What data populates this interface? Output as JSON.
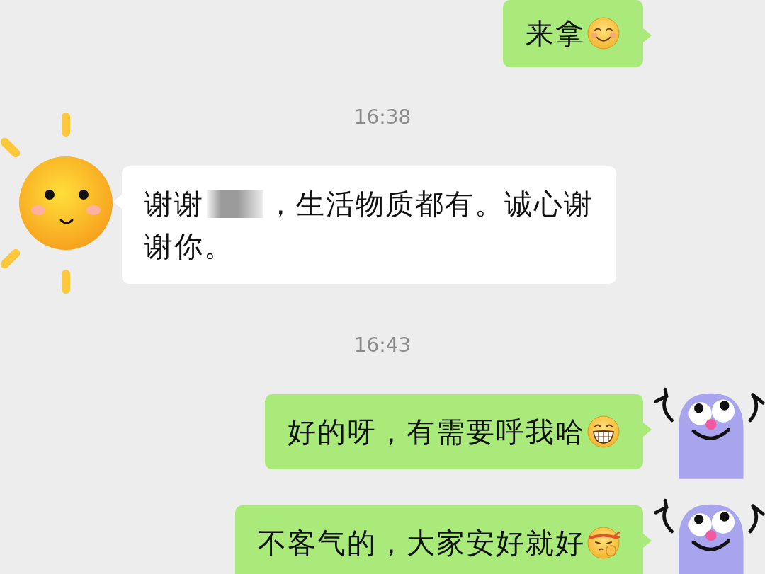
{
  "messages": [
    {
      "kind": "sent",
      "avatar_visible": false,
      "lines": [
        [
          {
            "kind": "text",
            "text": "来拿"
          },
          {
            "kind": "smile-emoji"
          }
        ]
      ]
    },
    {
      "kind": "time",
      "text": "16:38"
    },
    {
      "kind": "received",
      "avatar_visible": true,
      "lines": [
        [
          {
            "kind": "text",
            "text": "谢谢"
          },
          {
            "kind": "redacted"
          },
          {
            "kind": "text",
            "text": "，生活物质都有。诚心谢"
          }
        ],
        [
          {
            "kind": "text",
            "text": "谢你。"
          }
        ]
      ]
    },
    {
      "kind": "time",
      "text": "16:43"
    },
    {
      "kind": "sent",
      "avatar_visible": true,
      "lines": [
        [
          {
            "kind": "text",
            "text": "好的呀，有需要呼我哈"
          },
          {
            "kind": "grin-emoji"
          }
        ]
      ]
    },
    {
      "kind": "sent",
      "avatar_visible": true,
      "lines": [
        [
          {
            "kind": "text",
            "text": "不客气的，大家安好就好"
          },
          {
            "kind": "headband-emoji"
          }
        ]
      ]
    }
  ]
}
